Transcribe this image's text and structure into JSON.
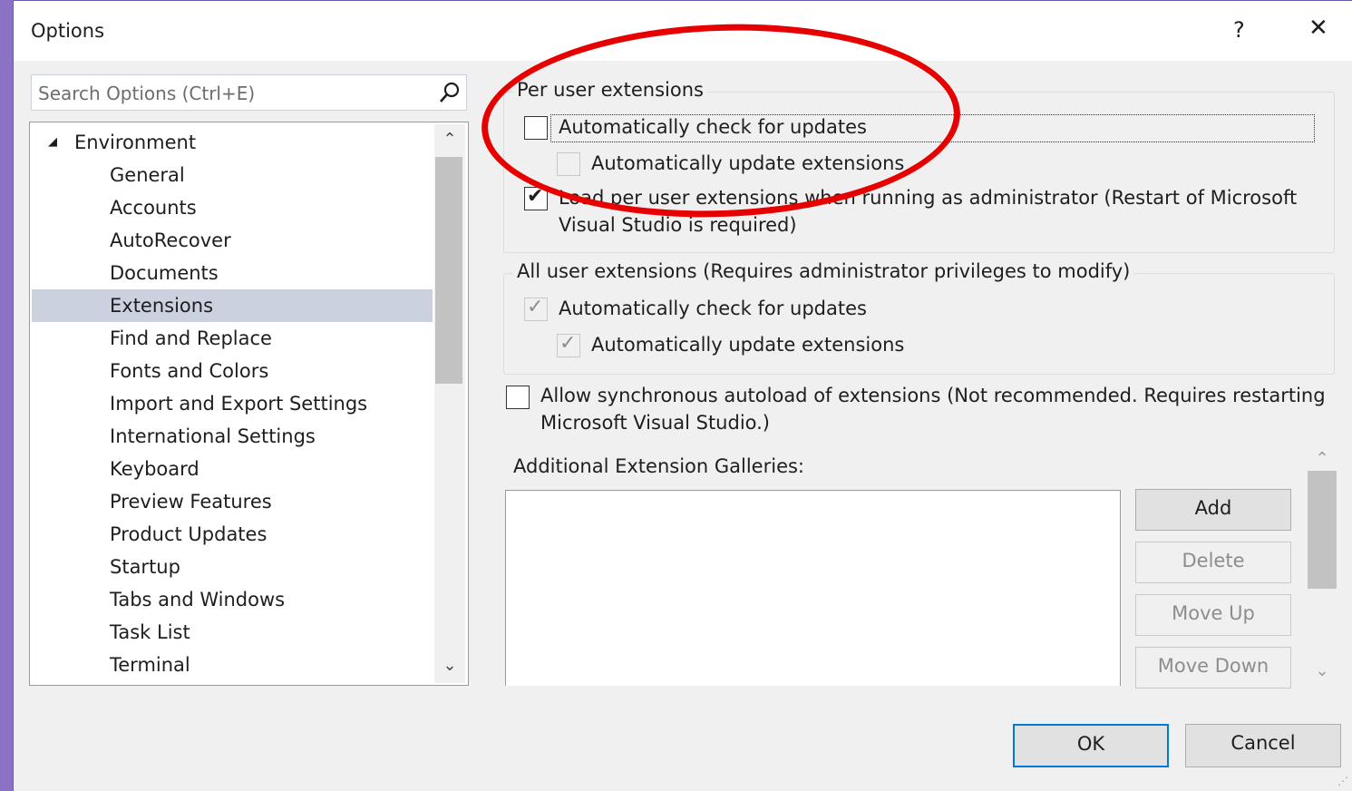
{
  "window": {
    "title": "Options",
    "help_label": "?",
    "close_label": "✕"
  },
  "search": {
    "placeholder": "Search Options (Ctrl+E)",
    "icon": "search-icon"
  },
  "tree": {
    "root": {
      "label": "Environment",
      "expander": "◢"
    },
    "items": [
      {
        "label": "General"
      },
      {
        "label": "Accounts"
      },
      {
        "label": "AutoRecover"
      },
      {
        "label": "Documents"
      },
      {
        "label": "Extensions",
        "selected": true
      },
      {
        "label": "Find and Replace"
      },
      {
        "label": "Fonts and Colors"
      },
      {
        "label": "Import and Export Settings"
      },
      {
        "label": "International Settings"
      },
      {
        "label": "Keyboard"
      },
      {
        "label": "Preview Features"
      },
      {
        "label": "Product Updates"
      },
      {
        "label": "Startup"
      },
      {
        "label": "Tabs and Windows"
      },
      {
        "label": "Task List"
      },
      {
        "label": "Terminal"
      }
    ],
    "scroll_up": "⌃",
    "scroll_down": "⌄"
  },
  "per_user": {
    "legend": "Per user extensions",
    "auto_check": {
      "label": "Automatically check for updates",
      "checked": false
    },
    "auto_update": {
      "label": "Automatically update extensions",
      "checked": false,
      "enabled": false
    },
    "load_admin": {
      "label_line1": "Load per user extensions when running as administrator (Restart of Microsoft",
      "label_line2": "Visual Studio is required)",
      "checked": true
    }
  },
  "all_user": {
    "legend": "All user extensions (Requires administrator privileges to modify)",
    "auto_check": {
      "label": "Automatically check for updates",
      "checked": true,
      "enabled": false
    },
    "auto_update": {
      "label": "Automatically update extensions",
      "checked": true,
      "enabled": false
    }
  },
  "sync_autoload": {
    "label_line1": "Allow synchronous autoload of extensions (Not recommended. Requires restarting",
    "label_line2": "Microsoft Visual Studio.)",
    "checked": false
  },
  "galleries": {
    "label": "Additional Extension Galleries:",
    "buttons": {
      "add": "Add",
      "delete": "Delete",
      "move_up": "Move Up",
      "move_down": "Move Down"
    }
  },
  "footer": {
    "ok": "OK",
    "cancel": "Cancel"
  },
  "colors": {
    "accent": "#0078d7",
    "annotation": "#e60000",
    "selection": "#ccd1e0"
  }
}
